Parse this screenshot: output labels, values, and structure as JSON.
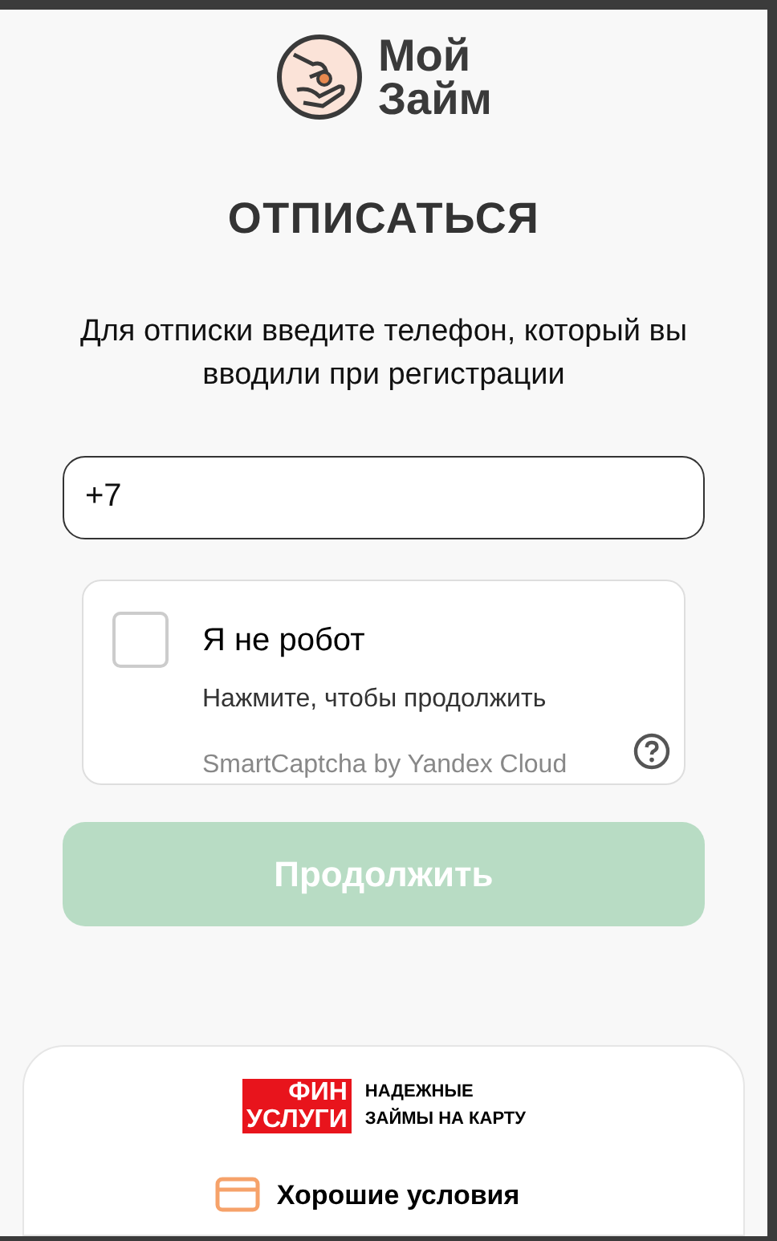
{
  "logo": {
    "line_1": "Мой",
    "line_2": "Займ"
  },
  "title": "ОТПИСАТЬСЯ",
  "instruction": "Для отписки введите телефон, который вы вводили при регистрации",
  "phone_field": {
    "value": "+7"
  },
  "captcha": {
    "checked": false,
    "label": "Я не робот",
    "hint": "Нажмите, чтобы продолжить",
    "brand": "SmartCaptcha by Yandex Cloud"
  },
  "continue_button": {
    "label": "Продолжить",
    "disabled": true
  },
  "footer_card": {
    "badge_line_1": "ФИН",
    "badge_line_2": "УСЛУГИ",
    "tagline_1": "НАДЕЖНЫЕ",
    "tagline_2": "ЗАЙМЫ НА КАРТУ",
    "feature": "Хорошие условия"
  }
}
